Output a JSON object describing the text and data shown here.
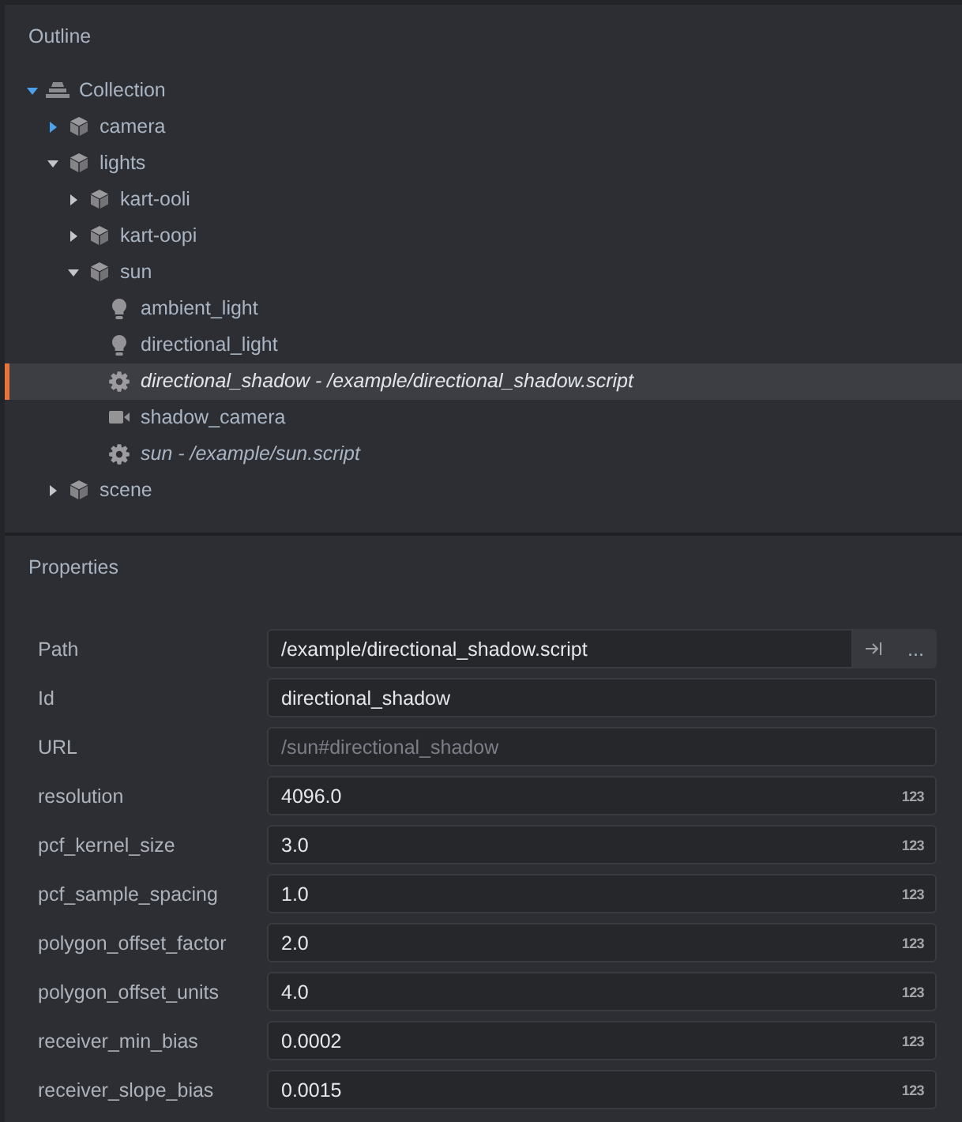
{
  "outline": {
    "title": "Outline",
    "tree": [
      {
        "label": "Collection",
        "kind": "collection",
        "expanded": true,
        "caret_highlighted": true,
        "selected": false,
        "children": [
          {
            "label": "camera",
            "kind": "game_object",
            "expanded": false,
            "caret_highlighted": true,
            "selected": false
          },
          {
            "label": "lights",
            "kind": "game_object",
            "expanded": true,
            "caret_highlighted": false,
            "selected": false,
            "children": [
              {
                "label": "kart-ooli",
                "kind": "game_object",
                "expanded": false,
                "caret_highlighted": false,
                "selected": false
              },
              {
                "label": "kart-oopi",
                "kind": "game_object",
                "expanded": false,
                "caret_highlighted": false,
                "selected": false
              },
              {
                "label": "sun",
                "kind": "game_object",
                "expanded": true,
                "caret_highlighted": false,
                "selected": false,
                "children": [
                  {
                    "label": "ambient_light",
                    "kind": "light",
                    "selected": false
                  },
                  {
                    "label": "directional_light",
                    "kind": "light",
                    "selected": false
                  },
                  {
                    "label": "directional_shadow - /example/directional_shadow.script",
                    "kind": "script",
                    "selected": true
                  },
                  {
                    "label": "shadow_camera",
                    "kind": "camera",
                    "selected": false
                  },
                  {
                    "label": "sun - /example/sun.script",
                    "kind": "script",
                    "selected": false
                  }
                ]
              }
            ]
          },
          {
            "label": "scene",
            "kind": "game_object",
            "expanded": false,
            "caret_highlighted": false,
            "selected": false
          }
        ]
      }
    ]
  },
  "properties": {
    "title": "Properties",
    "rows": [
      {
        "label": "Path",
        "kind": "resource",
        "value": "/example/directional_shadow.script",
        "buttons": [
          {
            "kind": "goto"
          },
          {
            "kind": "browse",
            "label": "..."
          }
        ]
      },
      {
        "label": "Id",
        "kind": "text",
        "value": "directional_shadow",
        "read_only": false
      },
      {
        "label": "URL",
        "kind": "text",
        "value": "/sun#directional_shadow",
        "read_only": true
      },
      {
        "label": "resolution",
        "kind": "number",
        "value": "4096.0",
        "badge": "123"
      },
      {
        "label": "pcf_kernel_size",
        "kind": "number",
        "value": "3.0",
        "badge": "123"
      },
      {
        "label": "pcf_sample_spacing",
        "kind": "number",
        "value": "1.0",
        "badge": "123"
      },
      {
        "label": "polygon_offset_factor",
        "kind": "number",
        "value": "2.0",
        "badge": "123"
      },
      {
        "label": "polygon_offset_units",
        "kind": "number",
        "value": "4.0",
        "badge": "123"
      },
      {
        "label": "receiver_min_bias",
        "kind": "number",
        "value": "0.0002",
        "badge": "123"
      },
      {
        "label": "receiver_slope_bias",
        "kind": "number",
        "value": "0.0015",
        "badge": "123"
      }
    ]
  }
}
